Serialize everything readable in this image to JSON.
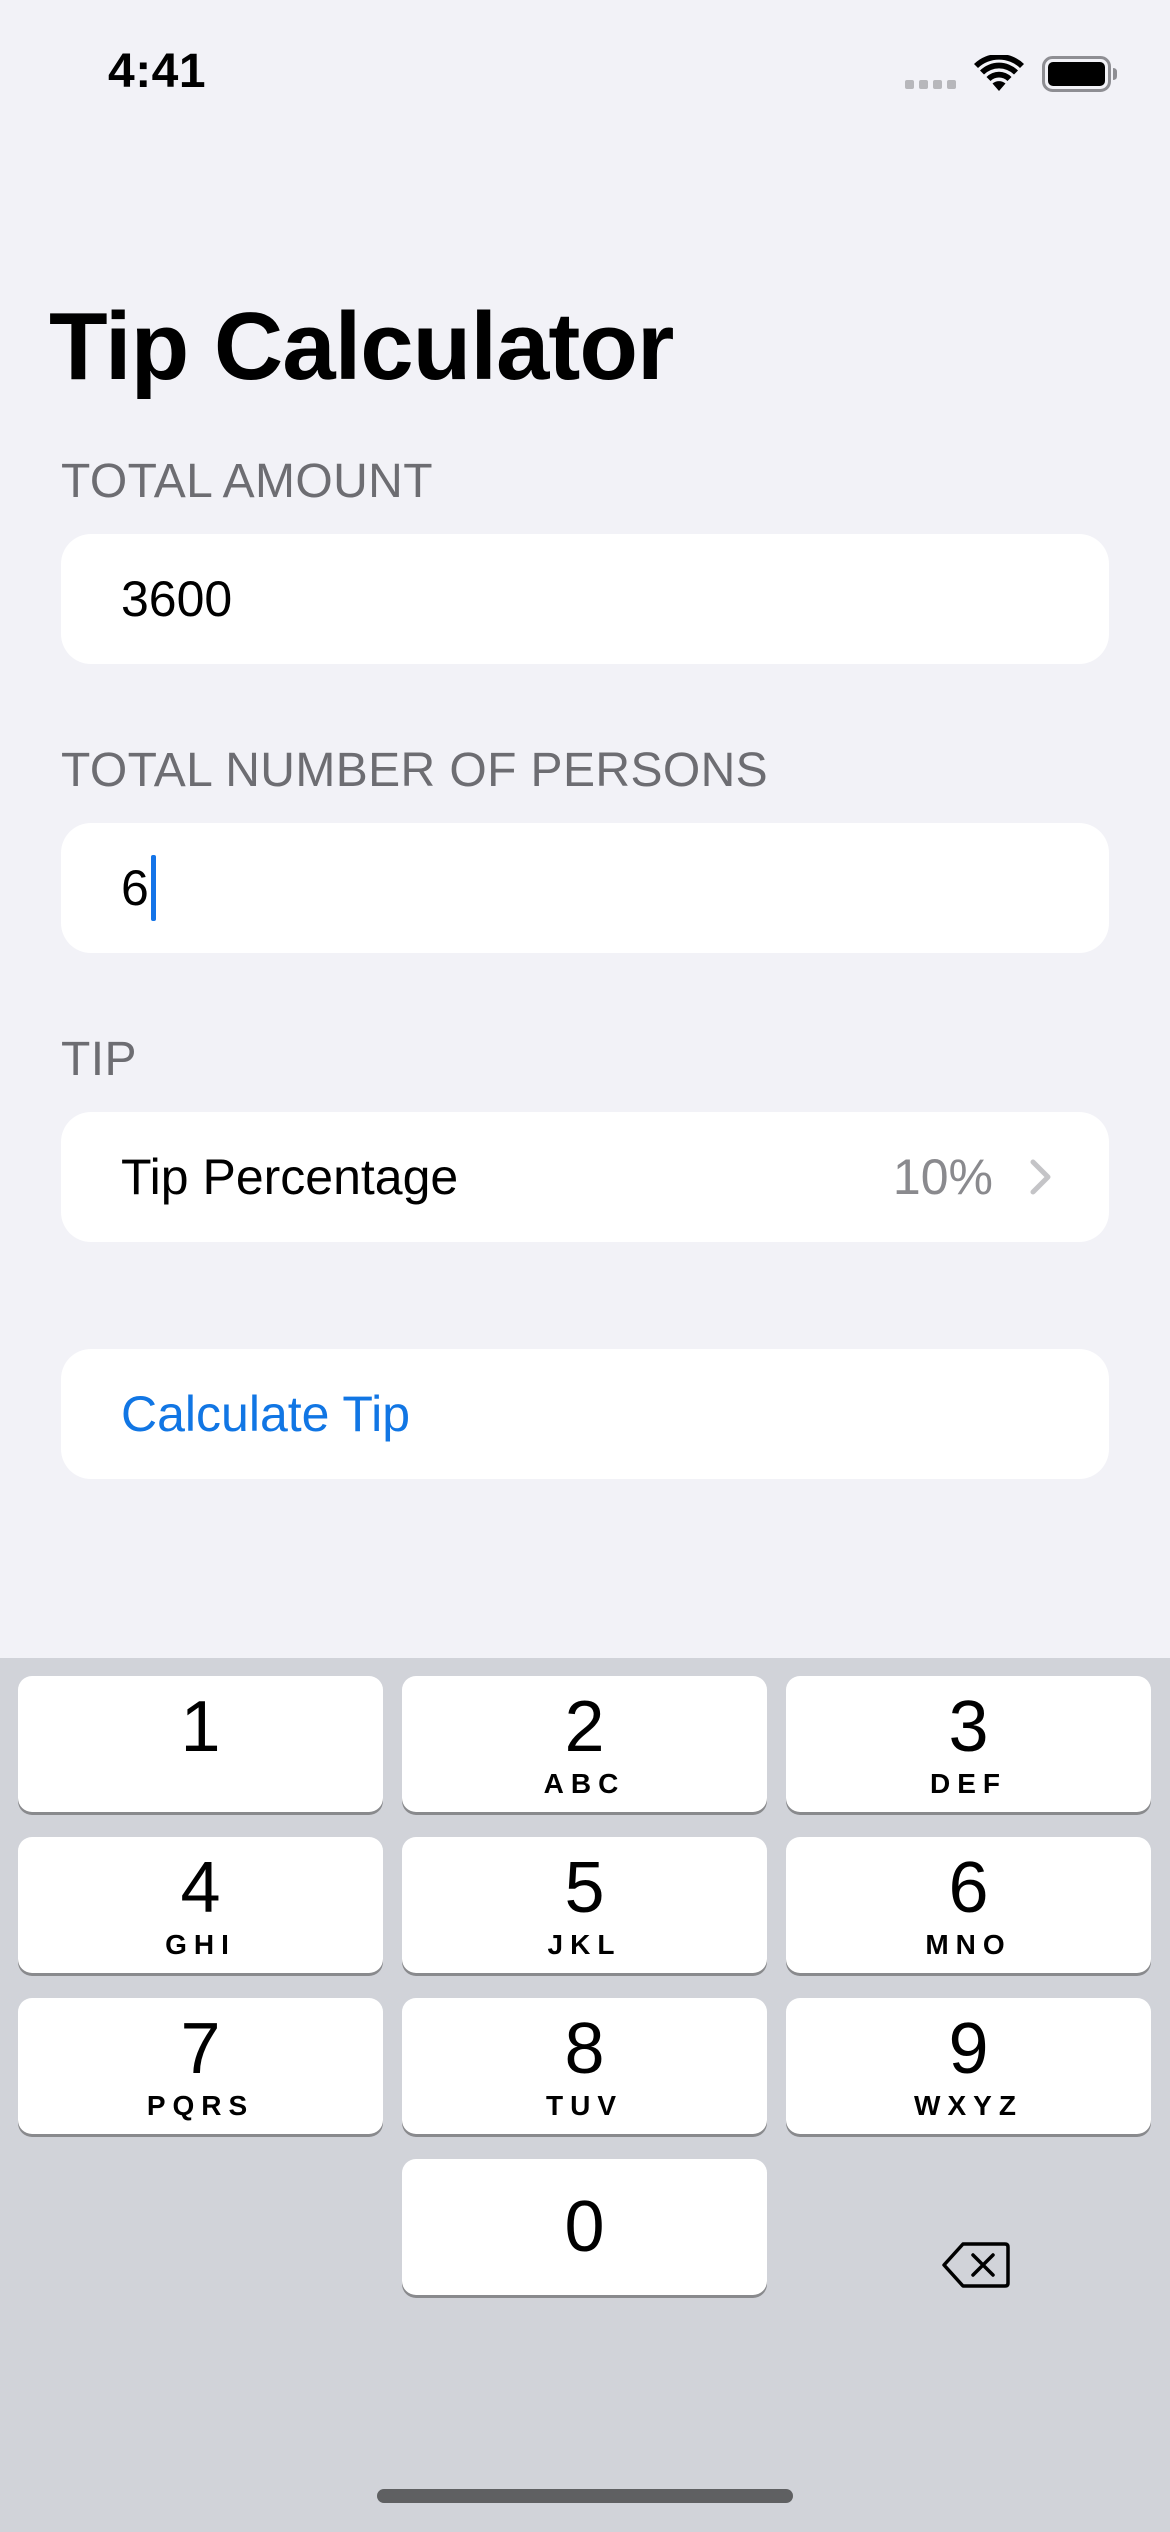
{
  "status_bar": {
    "time": "4:41"
  },
  "page": {
    "title": "Tip Calculator"
  },
  "form": {
    "total_amount": {
      "header": "TOTAL AMOUNT",
      "value": "3600"
    },
    "persons": {
      "header": "TOTAL NUMBER OF PERSONS",
      "value": "6"
    },
    "tip": {
      "header": "TIP",
      "row_label": "Tip Percentage",
      "row_value": "10%"
    },
    "calculate_button": {
      "label": "Calculate Tip"
    }
  },
  "keyboard": {
    "keys": [
      {
        "digit": "1",
        "letters": ""
      },
      {
        "digit": "2",
        "letters": "ABC"
      },
      {
        "digit": "3",
        "letters": "DEF"
      },
      {
        "digit": "4",
        "letters": "GHI"
      },
      {
        "digit": "5",
        "letters": "JKL"
      },
      {
        "digit": "6",
        "letters": "MNO"
      },
      {
        "digit": "7",
        "letters": "PQRS"
      },
      {
        "digit": "8",
        "letters": "TUV"
      },
      {
        "digit": "9",
        "letters": "WXYZ"
      },
      {
        "digit": "0",
        "letters": ""
      }
    ],
    "delete_icon": "delete-backspace-icon"
  },
  "colors": {
    "background": "#f2f2f7",
    "accent_link": "#1176e4",
    "caret": "#1474e8",
    "section_header": "#6d6d72",
    "keyboard_background": "#d1d3d9"
  },
  "icons": {
    "signal": "cellular-signal-icon",
    "wifi": "wifi-icon",
    "battery": "battery-icon",
    "chevron": "chevron-right-icon"
  }
}
